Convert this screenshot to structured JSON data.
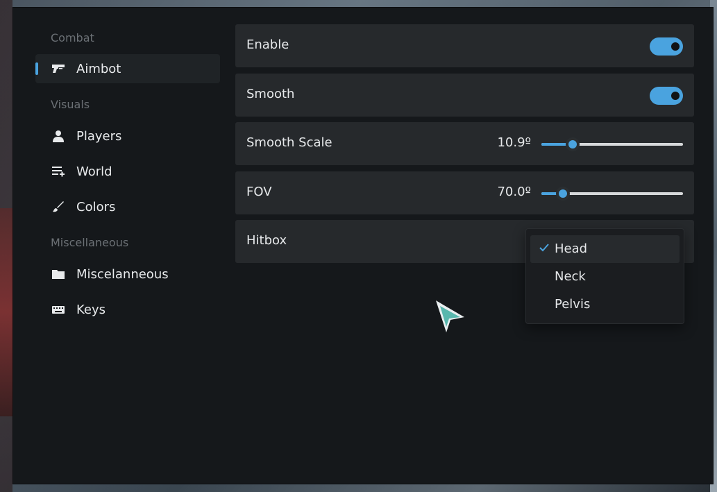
{
  "colors": {
    "accent": "#4aa3df",
    "window_bg": "#15181b",
    "row_bg": "#26292c"
  },
  "sidebar": {
    "sections": [
      {
        "label": "Combat",
        "items": [
          {
            "label": "Aimbot",
            "icon": "gun-icon",
            "active": true
          }
        ]
      },
      {
        "label": "Visuals",
        "items": [
          {
            "label": "Players",
            "icon": "person-icon"
          },
          {
            "label": "World",
            "icon": "list-add-icon"
          },
          {
            "label": "Colors",
            "icon": "brush-icon"
          }
        ]
      },
      {
        "label": "Miscellaneous",
        "items": [
          {
            "label": "Miscelanneous",
            "icon": "folder-icon"
          },
          {
            "label": "Keys",
            "icon": "keyboard-icon"
          }
        ]
      }
    ]
  },
  "settings": {
    "enable": {
      "label": "Enable",
      "on": true
    },
    "smooth": {
      "label": "Smooth",
      "on": true
    },
    "smooth_scale": {
      "label": "Smooth Scale",
      "value_text": "10.9º",
      "fraction": 0.22
    },
    "fov": {
      "label": "FOV",
      "value_text": "70.0º",
      "fraction": 0.15
    },
    "hitbox": {
      "label": "Hitbox",
      "options": [
        "Head",
        "Neck",
        "Pelvis"
      ],
      "selected": "Head"
    }
  }
}
